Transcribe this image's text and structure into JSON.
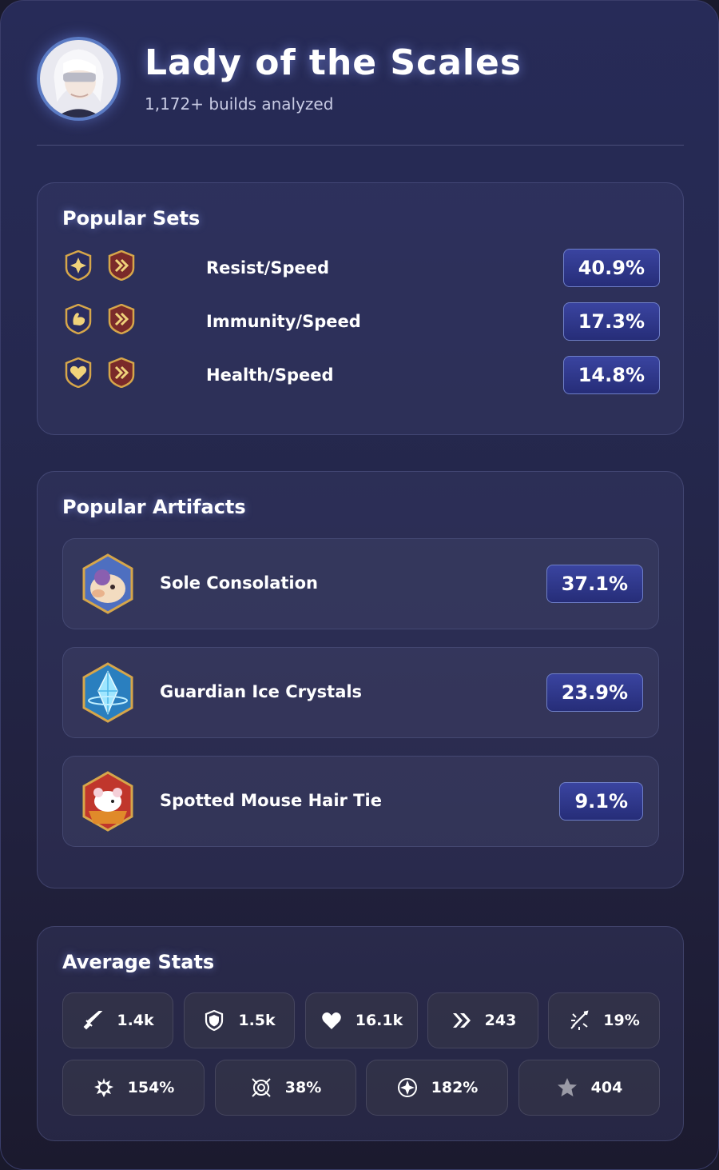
{
  "header": {
    "title": "Lady of the Scales",
    "subtitle": "1,172+ builds analyzed"
  },
  "sets": {
    "title": "Popular Sets",
    "items": [
      {
        "name": "Resist/Speed",
        "pct": "40.9%",
        "icons": [
          "resist-set-icon",
          "speed-set-icon"
        ]
      },
      {
        "name": "Immunity/Speed",
        "pct": "17.3%",
        "icons": [
          "immunity-set-icon",
          "speed-set-icon"
        ]
      },
      {
        "name": "Health/Speed",
        "pct": "14.8%",
        "icons": [
          "health-set-icon",
          "speed-set-icon"
        ]
      }
    ]
  },
  "artifacts": {
    "title": "Popular Artifacts",
    "items": [
      {
        "name": "Sole Consolation",
        "pct": "37.1%"
      },
      {
        "name": "Guardian Ice Crystals",
        "pct": "23.9%"
      },
      {
        "name": "Spotted Mouse Hair Tie",
        "pct": "9.1%"
      }
    ]
  },
  "stats": {
    "title": "Average Stats",
    "row1": [
      {
        "icon": "attack-icon",
        "value": "1.4k"
      },
      {
        "icon": "defense-icon",
        "value": "1.5k"
      },
      {
        "icon": "health-icon",
        "value": "16.1k"
      },
      {
        "icon": "speed-icon",
        "value": "243"
      },
      {
        "icon": "crit-chance-icon",
        "value": "19%"
      }
    ],
    "row2": [
      {
        "icon": "crit-damage-icon",
        "value": "154%"
      },
      {
        "icon": "effectiveness-icon",
        "value": "38%"
      },
      {
        "icon": "effect-resistance-icon",
        "value": "182%"
      },
      {
        "icon": "gear-score-icon",
        "value": "404"
      }
    ]
  },
  "colors": {
    "badge": "#2c3388",
    "set_icon_gold": "#d6a64a",
    "speed_set_red": "#7a2a2a"
  }
}
